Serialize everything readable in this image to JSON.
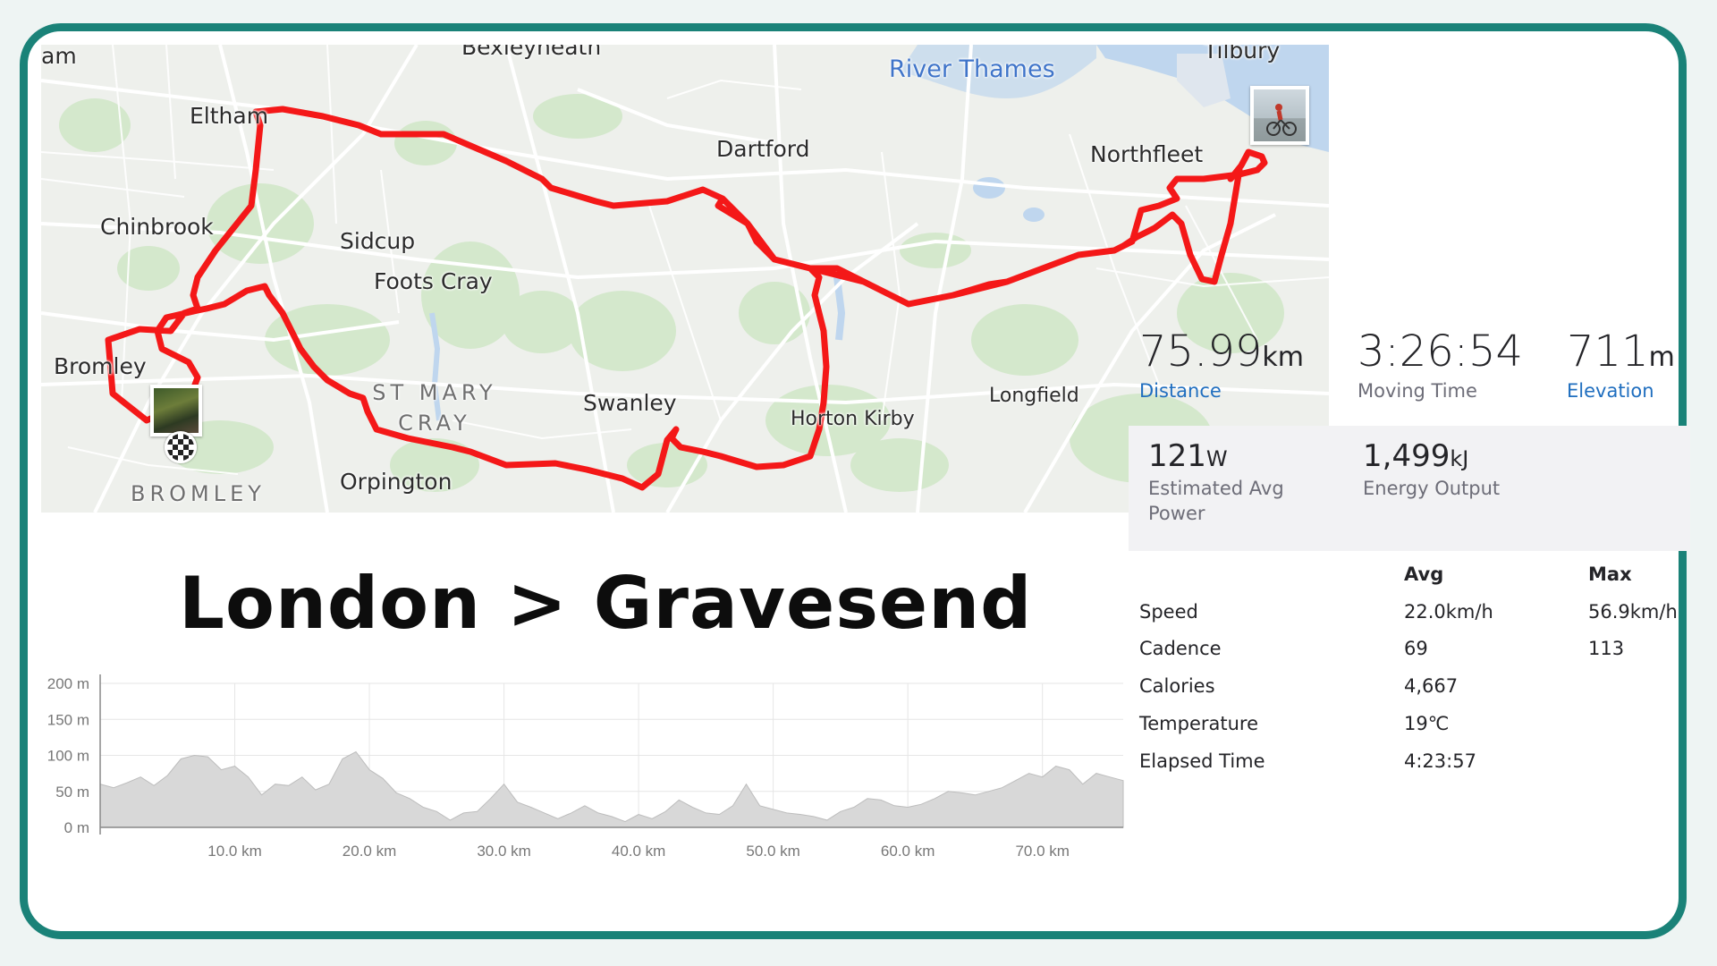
{
  "title": "London > Gravesend",
  "map": {
    "places": {
      "partial_left": "am",
      "bexleyheath": "Bexleyheath",
      "tilbury": "Tilbury",
      "river_thames": "River Thames",
      "eltham": "Eltham",
      "dartford": "Dartford",
      "northfleet": "Northfleet",
      "chinbrook": "Chinbrook",
      "sidcup": "Sidcup",
      "foots_cray": "Foots Cray",
      "bromley": "Bromley",
      "st_mary_cray": "ST MARY CRAY",
      "swanley": "Swanley",
      "longfield": "Longfield",
      "horton_kirby": "Horton Kirby",
      "bromley_district": "BROMLEY",
      "orpington": "Orpington"
    },
    "route_color": "#f41818",
    "markers": {
      "start": "photo-marker",
      "finish": "checkered-flag-icon",
      "end_photo": "cyclist-photo-marker"
    }
  },
  "stats": {
    "distance": {
      "value": "75.99",
      "unit": "km",
      "label": "Distance"
    },
    "moving_time": {
      "value": "3:26:54",
      "label": "Moving Time"
    },
    "elevation": {
      "value": "711",
      "unit": "m",
      "label": "Elevation"
    },
    "power": {
      "value": "121",
      "unit": "W",
      "label_line1": "Estimated Avg",
      "label_line2": "Power"
    },
    "energy": {
      "value": "1,499",
      "unit": "kJ",
      "label": "Energy Output"
    }
  },
  "details": {
    "headers": {
      "avg": "Avg",
      "max": "Max"
    },
    "rows": [
      {
        "label": "Speed",
        "avg": "22.0km/h",
        "max": "56.9km/h"
      },
      {
        "label": "Cadence",
        "avg": "69",
        "max": "113"
      },
      {
        "label": "Calories",
        "avg": "4,667",
        "max": ""
      },
      {
        "label": "Temperature",
        "avg": "19℃",
        "max": ""
      },
      {
        "label": "Elapsed Time",
        "avg": "4:23:57",
        "max": ""
      }
    ]
  },
  "chart_data": {
    "type": "area",
    "title": "",
    "xlabel": "",
    "ylabel": "",
    "x_unit": "km",
    "y_unit": "m",
    "xlim": [
      0,
      76
    ],
    "ylim": [
      0,
      200
    ],
    "x_ticks": [
      "10.0 km",
      "20.0 km",
      "30.0 km",
      "40.0 km",
      "50.0 km",
      "60.0 km",
      "70.0 km"
    ],
    "y_ticks": [
      "200 m",
      "150 m",
      "100 m",
      "50 m",
      "0 m"
    ],
    "grid": true,
    "x": [
      0,
      1,
      2,
      3,
      4,
      5,
      6,
      7,
      8,
      9,
      10,
      11,
      12,
      13,
      14,
      15,
      16,
      17,
      18,
      19,
      20,
      21,
      22,
      23,
      24,
      25,
      26,
      27,
      28,
      29,
      30,
      31,
      32,
      33,
      34,
      35,
      36,
      37,
      38,
      39,
      40,
      41,
      42,
      43,
      44,
      45,
      46,
      47,
      48,
      49,
      50,
      51,
      52,
      53,
      54,
      55,
      56,
      57,
      58,
      59,
      60,
      61,
      62,
      63,
      64,
      65,
      66,
      67,
      68,
      69,
      70,
      71,
      72,
      73,
      74,
      75,
      76
    ],
    "y": [
      60,
      55,
      62,
      70,
      58,
      72,
      95,
      100,
      98,
      80,
      85,
      70,
      45,
      60,
      58,
      70,
      52,
      60,
      95,
      105,
      80,
      68,
      48,
      40,
      28,
      22,
      10,
      20,
      22,
      40,
      60,
      35,
      28,
      20,
      12,
      20,
      30,
      20,
      15,
      8,
      18,
      12,
      22,
      38,
      28,
      20,
      18,
      30,
      60,
      30,
      25,
      20,
      18,
      15,
      10,
      22,
      28,
      40,
      38,
      30,
      28,
      32,
      40,
      50,
      48,
      45,
      50,
      55,
      65,
      75,
      70,
      85,
      80,
      60,
      75,
      70,
      65
    ]
  }
}
